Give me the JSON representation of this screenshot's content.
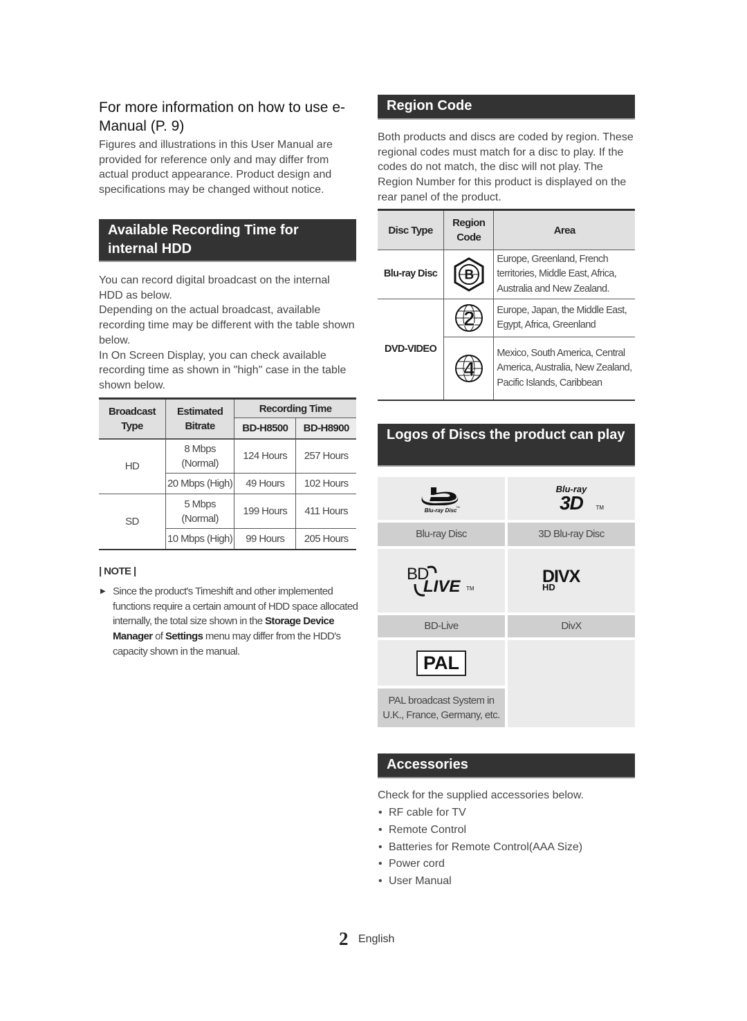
{
  "intro": {
    "title": "For more information on how to use e-Manual (P. 9)",
    "paragraph": "Figures and illustrations in this User Manual are provided for reference only and may differ from actual product appearance. Product design and specifications may be changed without notice."
  },
  "hdd_section": {
    "heading": "Available Recording Time for internal HDD",
    "paragraphs": [
      "You can record digital broadcast on the internal HDD as below.",
      "Depending on the actual broadcast, available recording time may be different with the table shown below.",
      "In On Screen Display, you can check available recording time as shown in \"high\" case in the table shown below."
    ],
    "table": {
      "headers": {
        "broadcast_type": "Broadcast Type",
        "estimated_bitrate": "Estimated Bitrate",
        "recording_time": "Recording Time",
        "model_1": "BD-H8500",
        "model_2": "BD-H8900"
      },
      "rows": [
        {
          "type": "HD",
          "bitrate": "8 Mbps (Normal)",
          "model_1": "124 Hours",
          "model_2": "257 Hours"
        },
        {
          "type": "HD",
          "bitrate": "20 Mbps (High)",
          "model_1": "49 Hours",
          "model_2": "102 Hours"
        },
        {
          "type": "SD",
          "bitrate": "5 Mbps (Normal)",
          "model_1": "199 Hours",
          "model_2": "411 Hours"
        },
        {
          "type": "SD",
          "bitrate": "10 Mbps (High)",
          "model_1": "99 Hours",
          "model_2": "205 Hours"
        }
      ],
      "groups": {
        "hd": "HD",
        "sd": "SD"
      }
    },
    "note": {
      "label": "| NOTE |",
      "text_1": "Since the product's Timeshift and other implemented functions require a certain amount of HDD space allocated internally, the total size shown in the ",
      "bold_1": "Storage Device Manager",
      "text_2": " of ",
      "bold_2": "Settings",
      "text_3": " menu may differ from the HDD's capacity shown in the manual."
    }
  },
  "region_section": {
    "heading": "Region Code",
    "paragraph": "Both products and discs are coded by region. These regional codes must match for a disc to play. If the codes do not match, the disc will not play. The Region Number for this product is displayed on the rear panel of the product.",
    "table": {
      "headers": {
        "disc_type": "Disc Type",
        "region_code": "Region Code",
        "area": "Area"
      },
      "rows": [
        {
          "disc_type": "Blu-ray Disc",
          "code": "B",
          "area": "Europe, Greenland, French territories, Middle East, Africa, Australia and New Zealand."
        },
        {
          "disc_type": "DVD-VIDEO",
          "code": "2",
          "area": "Europe, Japan, the Middle East, Egypt, Africa, Greenland"
        },
        {
          "disc_type": "DVD-VIDEO",
          "code": "4",
          "area": "Mexico, South America, Central America, Australia, New Zealand, Pacific Islands, Caribbean"
        }
      ]
    }
  },
  "logos_section": {
    "heading": "Logos of Discs the product can play",
    "logos": [
      {
        "name": "Blu-ray Disc",
        "logo_text": "Blu-ray Disc",
        "caption": "Blu-ray Disc"
      },
      {
        "name": "3D Blu-ray Disc",
        "logo_text_1": "Blu-ray",
        "logo_text_2": "3D",
        "tm": "TM",
        "caption": "3D Blu-ray Disc"
      },
      {
        "name": "BD-Live",
        "logo_text_1": "BD",
        "logo_text_2": "LIVE",
        "tm": "TM",
        "caption": "BD-Live"
      },
      {
        "name": "DivX",
        "logo_text_1": "DIVX",
        "logo_text_2": "HD",
        "caption": "DivX"
      },
      {
        "name": "PAL",
        "logo_text": "PAL",
        "caption": "PAL broadcast System in U.K., France, Germany, etc."
      }
    ]
  },
  "accessories_section": {
    "heading": "Accessories",
    "paragraph": "Check for the supplied accessories below.",
    "items": [
      "RF cable for TV",
      "Remote Control",
      "Batteries for Remote Control(AAA Size)",
      "Power cord",
      "User Manual"
    ]
  },
  "footer": {
    "page_number": "2",
    "language": "English"
  }
}
